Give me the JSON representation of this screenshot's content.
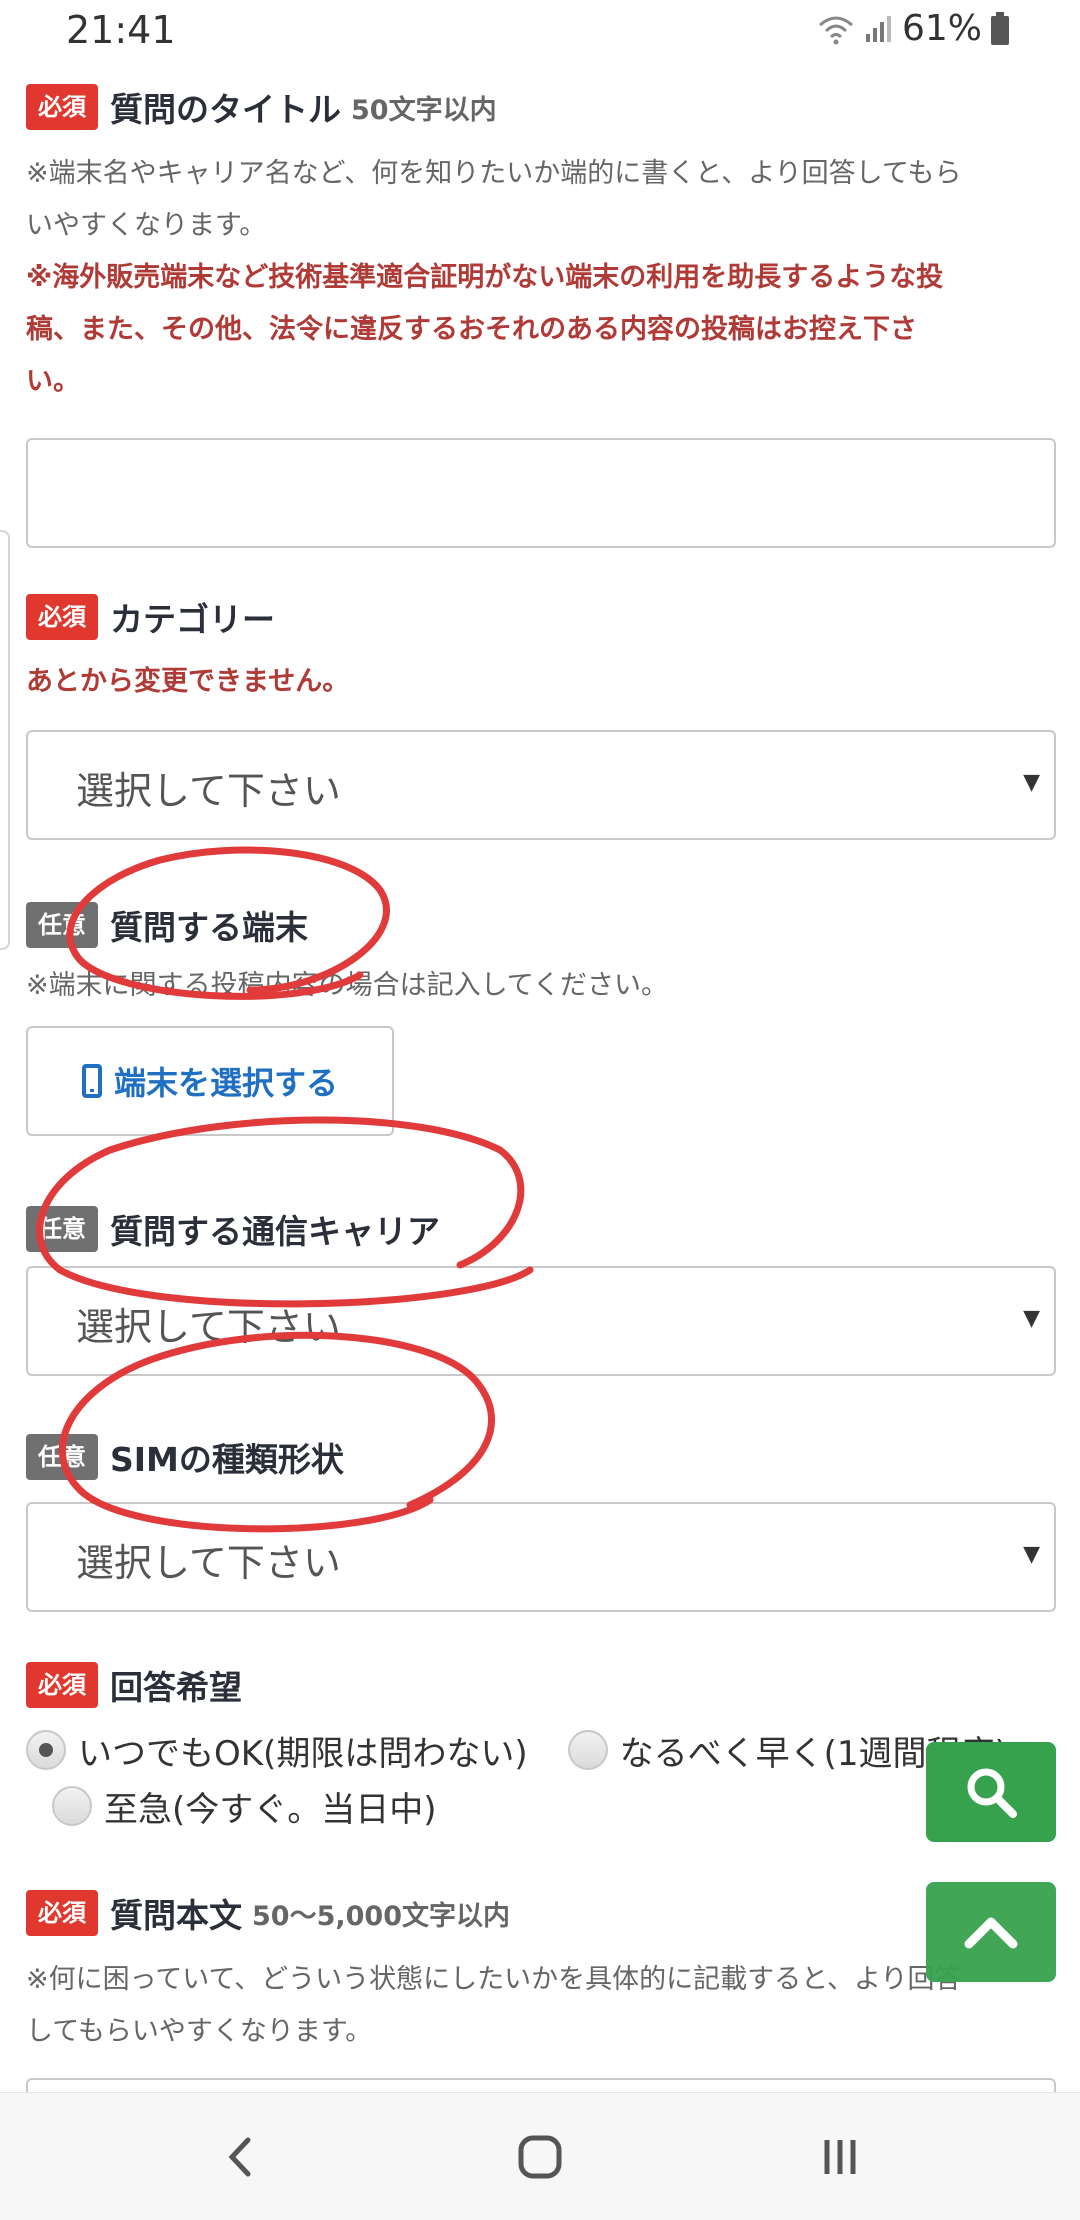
{
  "status_bar": {
    "time": "21:41",
    "battery": "61%"
  },
  "fields": {
    "title": {
      "badge": "必須",
      "label": "質問のタイトル",
      "limit": "50文字以内",
      "note_line1": "※端末名やキャリア名など、何を知りたいか端的に書くと、より回答してもら",
      "note_line2": "いやすくなります。",
      "warn_line1": "※海外販売端末など技術基準適合証明がない端末の利用を助長するような投",
      "warn_line2": "稿、また、その他、法令に違反するおそれのある内容の投稿はお控え下さ",
      "warn_line3": "い。",
      "value": ""
    },
    "category": {
      "badge": "必須",
      "label": "カテゴリー",
      "warn": "あとから変更できません。",
      "selected": "選択して下さい"
    },
    "device": {
      "badge": "任意",
      "label": "質問する端末",
      "note": "※端末に関する投稿内容の場合は記入してください。",
      "button_label": "端末を選択する"
    },
    "carrier": {
      "badge": "任意",
      "label": "質問する通信キャリア",
      "selected": "選択して下さい"
    },
    "sim": {
      "badge": "任意",
      "label": "SIMの種類形状",
      "selected": "選択して下さい"
    },
    "urgency": {
      "badge": "必須",
      "label": "回答希望",
      "options": [
        {
          "label": "いつでもOK(期限は問わない)",
          "checked": true
        },
        {
          "label": "なるべく早く(1週間程度)",
          "checked": false
        },
        {
          "label": "至急(今すぐ。当日中)",
          "checked": false
        }
      ]
    },
    "body": {
      "badge": "必須",
      "label": "質問本文",
      "limit": "50〜5,000文字以内",
      "note_line1": "※何に困っていて、どういう状態にしたいかを具体的に記載すると、より回答",
      "note_line2": "してもらいやすくなります。"
    }
  },
  "fab": {
    "search_icon": "search-icon",
    "top_icon": "chevron-up-icon"
  },
  "nav": {
    "back_icon": "back-icon",
    "home_icon": "home-icon",
    "recents_icon": "recents-icon"
  },
  "colors": {
    "required": "#e0382e",
    "optional": "#707070",
    "warning": "#b03a36",
    "link": "#1f6fc2",
    "fab": "#37a24e",
    "annotation": "#e03a3a"
  }
}
